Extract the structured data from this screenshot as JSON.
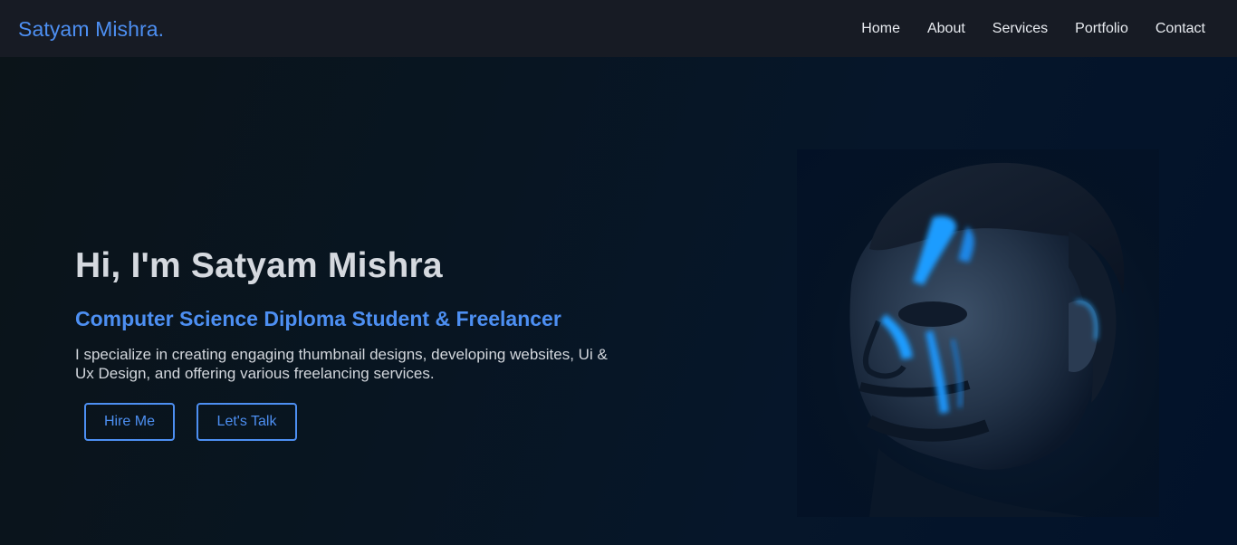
{
  "nav": {
    "brand": "Satyam Mishra.",
    "links": [
      "Home",
      "About",
      "Services",
      "Portfolio",
      "Contact"
    ]
  },
  "hero": {
    "title": "Hi, I'm Satyam Mishra",
    "subtitle": "Computer Science Diploma Student & Freelancer",
    "description": "I specialize in creating engaging thumbnail designs, developing websites, Ui & Ux Design, and offering various freelancing services.",
    "buttons": {
      "hire": "Hire Me",
      "talk": "Let's Talk"
    }
  },
  "colors": {
    "accent": "#4d8ff2",
    "navbar_bg": "#171b24",
    "hero_bg": "#06162a",
    "paint_glow": "#1f9bff"
  }
}
